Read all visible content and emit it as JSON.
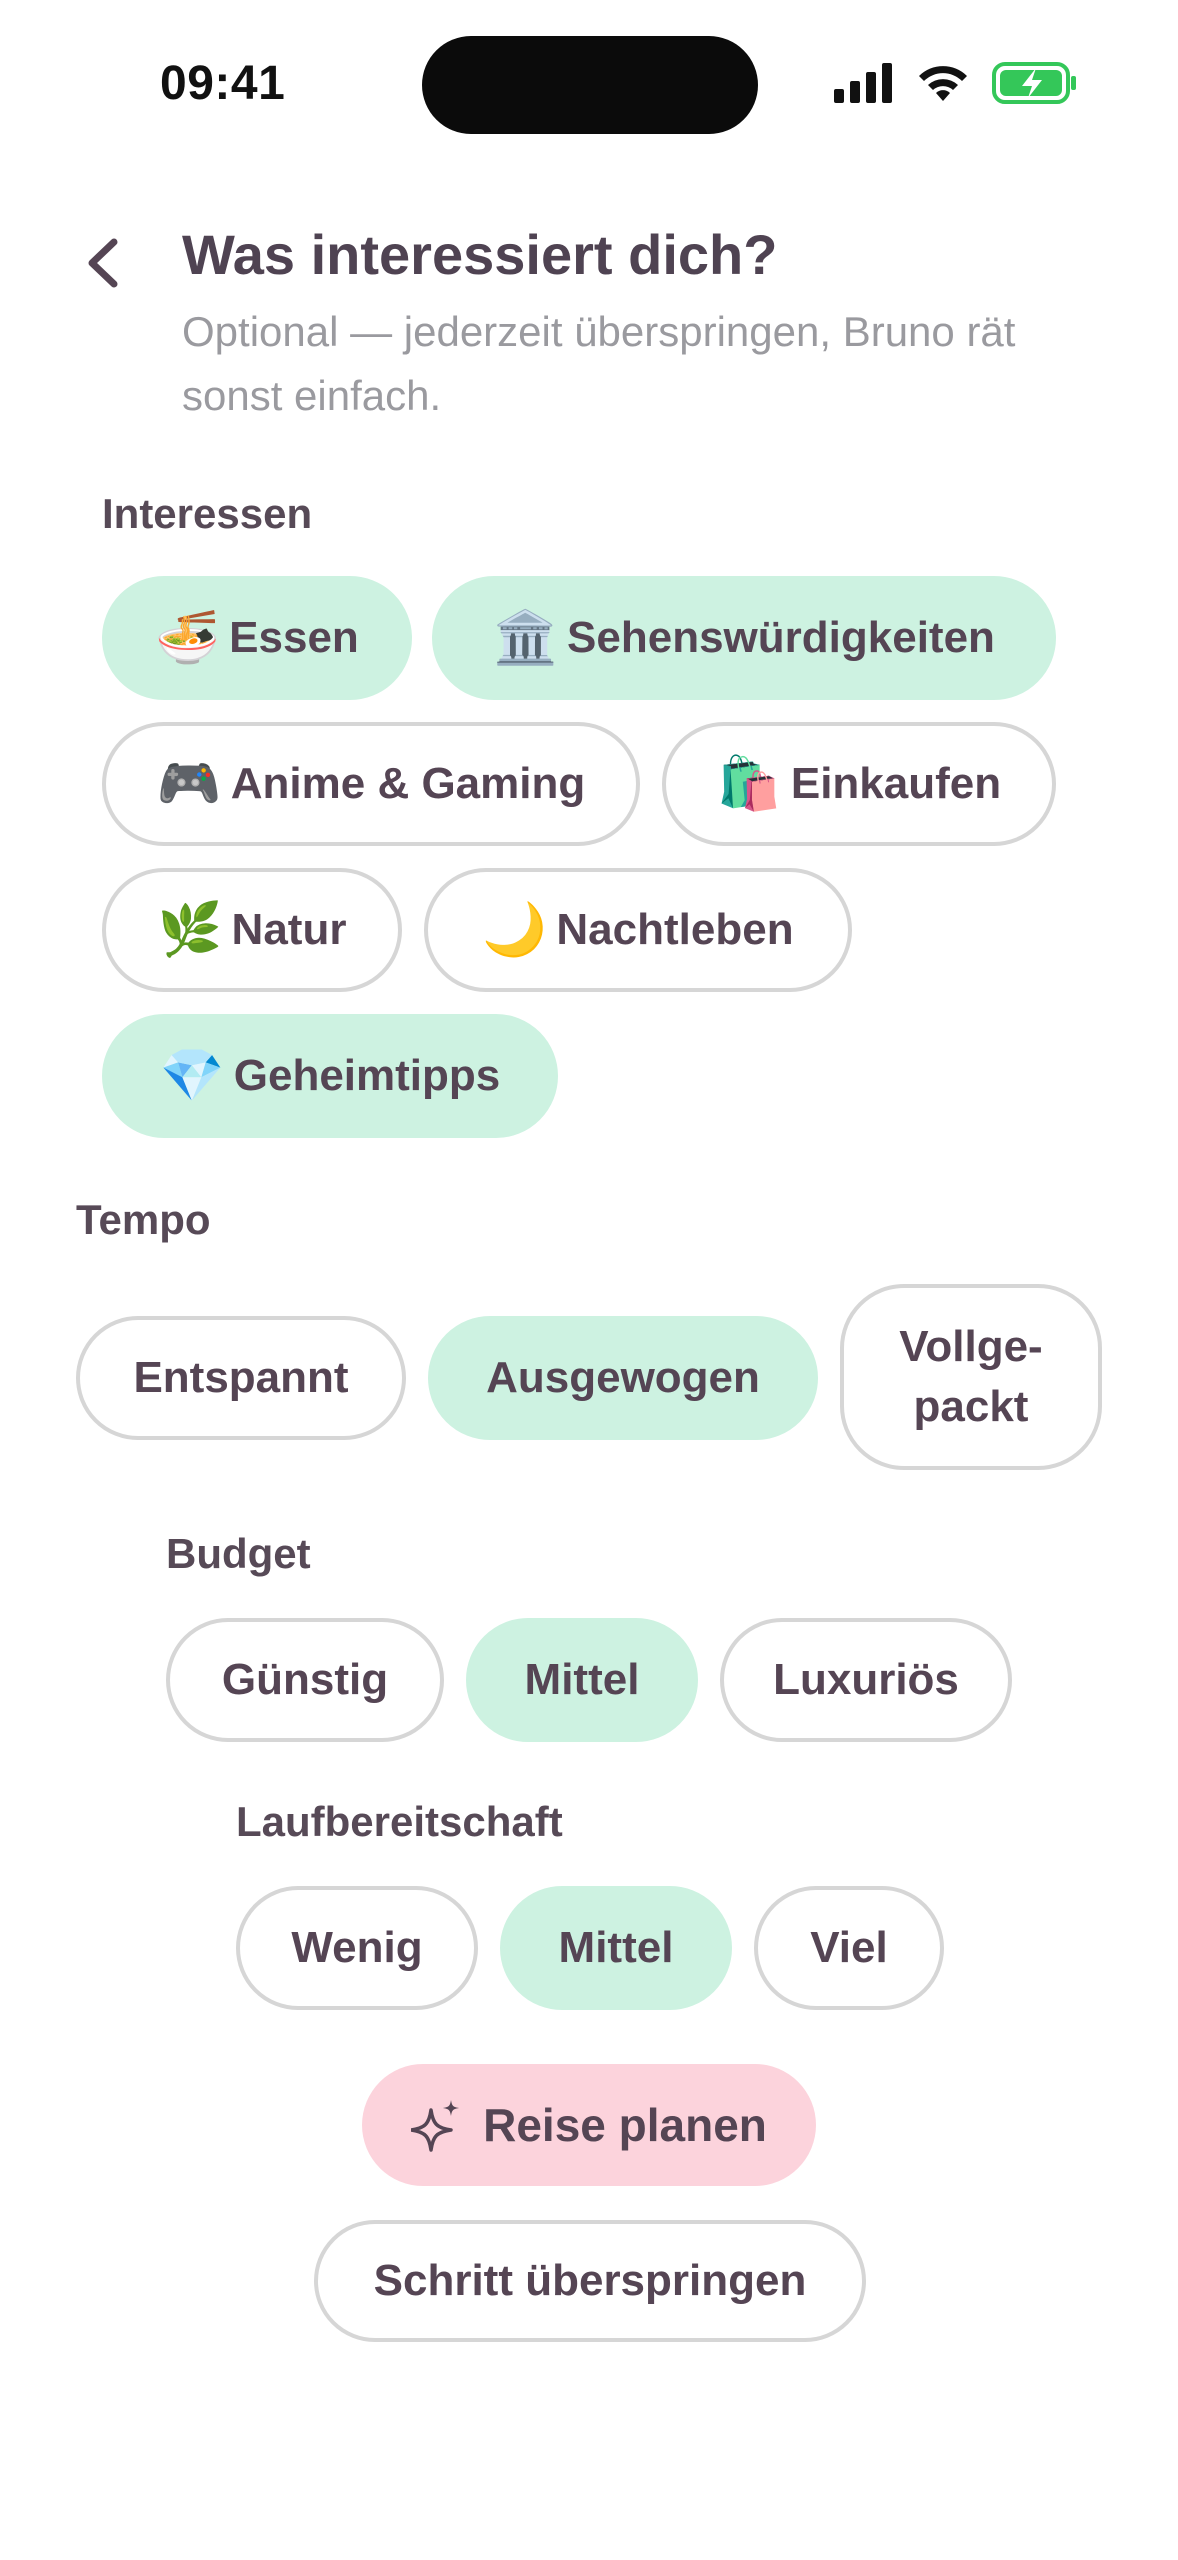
{
  "status_bar": {
    "time": "09:41"
  },
  "header": {
    "title": "Was interessiert dich?",
    "subtitle": "Optional — jederzeit überspringen, Bruno rät sonst einfach."
  },
  "interests": {
    "label": "Interessen",
    "items": [
      {
        "emoji": "🍜",
        "label": "Essen",
        "selected": true
      },
      {
        "emoji": "🏛️",
        "label": "Sehenswürdigkeiten",
        "selected": true
      },
      {
        "emoji": "🎮",
        "label": "Anime & Gaming",
        "selected": false
      },
      {
        "emoji": "🛍️",
        "label": "Einkaufen",
        "selected": false
      },
      {
        "emoji": "🌿",
        "label": "Natur",
        "selected": false
      },
      {
        "emoji": "🌙",
        "label": "Nachtleben",
        "selected": false
      },
      {
        "emoji": "💎",
        "label": "Geheimtipps",
        "selected": true
      }
    ]
  },
  "tempo": {
    "label": "Tempo",
    "options": [
      {
        "label": "Entspannt",
        "selected": false
      },
      {
        "label": "Ausgewogen",
        "selected": true
      },
      {
        "label": "Vollge-\npackt",
        "selected": false
      }
    ]
  },
  "budget": {
    "label": "Budget",
    "options": [
      {
        "label": "Günstig",
        "selected": false
      },
      {
        "label": "Mittel",
        "selected": true
      },
      {
        "label": "Luxuriös",
        "selected": false
      }
    ]
  },
  "walking": {
    "label": "Laufbereitschaft",
    "options": [
      {
        "label": "Wenig",
        "selected": false
      },
      {
        "label": "Mittel",
        "selected": true
      },
      {
        "label": "Viel",
        "selected": false
      }
    ]
  },
  "actions": {
    "plan_label": "Reise planen",
    "skip_label": "Schritt überspringen"
  },
  "colors": {
    "selected_chip": "#cdf2e1",
    "primary_button": "#fcd3dc",
    "text": "#554554",
    "battery": "#34c759"
  }
}
